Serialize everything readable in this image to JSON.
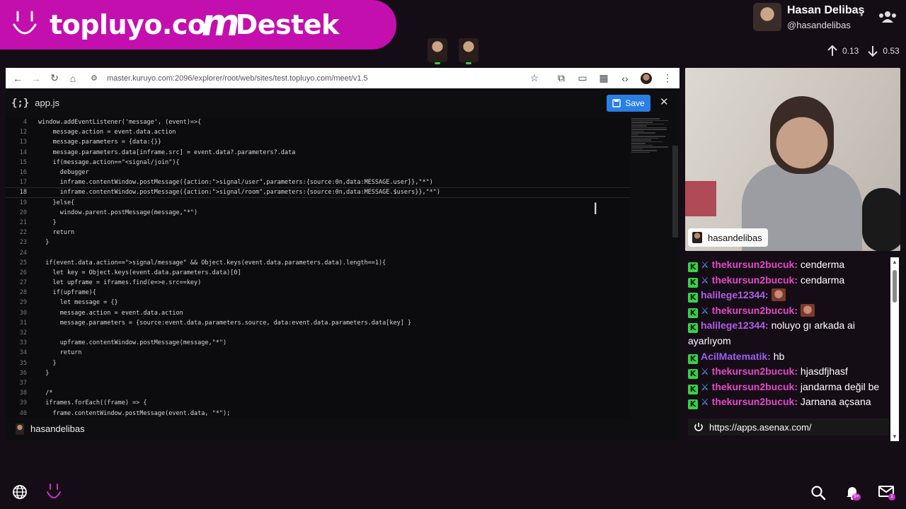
{
  "banner": {
    "brand_left": "topluyo.co",
    "brand_mid": "m",
    "brand_right": "Destek"
  },
  "user": {
    "name": "Hasan Delibaş",
    "handle": "@hasandelibas",
    "upload": "0.13",
    "download": "0.53"
  },
  "browser": {
    "url": "master.kuruyo.com:2096/explorer/root/web/sites/test.topluyo.com/meet/v1.5"
  },
  "editor": {
    "file_icon": "{;}",
    "file_name": "app.js",
    "save_label": "Save",
    "lines": [
      {
        "n": "4",
        "code": "window.addEventListener('message', (event)=>{"
      },
      {
        "n": "12",
        "code": "    message.action = event.data.action"
      },
      {
        "n": "13",
        "code": "    message.parameters = {data:{}}"
      },
      {
        "n": "14",
        "code": "    message.parameters.data[inframe.src] = event.data?.parameters?.data"
      },
      {
        "n": "15",
        "code": "    if(message.action==\"<signal/join\"){"
      },
      {
        "n": "16",
        "code": "      debugger"
      },
      {
        "n": "17",
        "code": "      inframe.contentWindow.postMessage({action:\">signal/user\",parameters:{source:0n,data:MESSAGE.user}},\"*\")"
      },
      {
        "n": "18",
        "code": "      inframe.contentWindow.postMessage({action:\">signal/room\",parameters:{source:0n,data:MESSAGE.$users}},\"*\")"
      },
      {
        "n": "19",
        "code": "    }else{"
      },
      {
        "n": "20",
        "code": "      window.parent.postMessage(message,\"*\")"
      },
      {
        "n": "21",
        "code": "    }"
      },
      {
        "n": "22",
        "code": "    return"
      },
      {
        "n": "23",
        "code": "  }"
      },
      {
        "n": "24",
        "code": ""
      },
      {
        "n": "25",
        "code": "  if(event.data.action==\">signal/message\" && Object.keys(event.data.parameters.data).length==1){"
      },
      {
        "n": "26",
        "code": "    let key = Object.keys(event.data.parameters.data)[0]"
      },
      {
        "n": "27",
        "code": "    let upframe = iframes.find(e=>e.src==key)"
      },
      {
        "n": "28",
        "code": "    if(upframe){"
      },
      {
        "n": "29",
        "code": "      let message = {}"
      },
      {
        "n": "30",
        "code": "      message.action = event.data.action"
      },
      {
        "n": "31",
        "code": "      message.parameters = {source:event.data.parameters.source, data:event.data.parameters.data[key] }"
      },
      {
        "n": "32",
        "code": ""
      },
      {
        "n": "33",
        "code": "      upframe.contentWindow.postMessage(message,\"*\")"
      },
      {
        "n": "34",
        "code": "      return"
      },
      {
        "n": "35",
        "code": "    }"
      },
      {
        "n": "36",
        "code": "  }"
      },
      {
        "n": "37",
        "code": ""
      },
      {
        "n": "38",
        "code": "  /*"
      },
      {
        "n": "39",
        "code": "  iframes.forEach((frame) => {"
      },
      {
        "n": "40",
        "code": "    frame.contentWindow.postMessage(event.data, \"*\");"
      }
    ],
    "footer_user": "hasandelibas"
  },
  "webcam": {
    "label": "hasandelibas"
  },
  "chat": {
    "messages": [
      {
        "user": "thekursun2bucuk:",
        "text": "cenderma"
      },
      {
        "user": "thekursun2bucuk:",
        "text": "cendarma"
      },
      {
        "user": "halilege12344:",
        "text": ""
      },
      {
        "user": "thekursun2bucuk:",
        "text": ""
      },
      {
        "user": "halilege12344:",
        "text": "noluyo gı arkada ai ayarlıyom"
      },
      {
        "user": "AcilMatematik:",
        "text": "hb"
      },
      {
        "user": "thekursun2bucuk:",
        "text": "hjasdfjhasf"
      },
      {
        "user": "thekursun2bucuk:",
        "text": "jandarma değil be"
      },
      {
        "user": "thekursun2bucuk:",
        "text": "Jarnana açsana"
      }
    ],
    "link": "https://apps.asenax.com/"
  },
  "bottom": {
    "notif_count": "9+",
    "mail_count": "1"
  },
  "colors": {
    "banner": "#c30fae",
    "save": "#2a7fe3",
    "kick_green": "#35d346"
  }
}
